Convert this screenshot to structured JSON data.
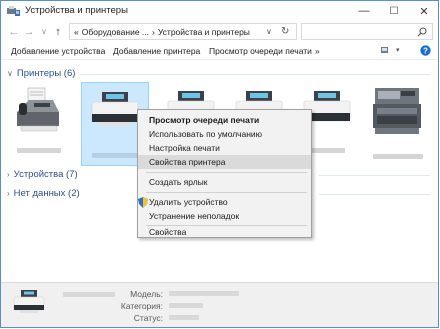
{
  "window": {
    "title": "Устройства и принтеры",
    "minimize_glyph": "—",
    "maximize_glyph": "☐",
    "close_glyph": "✕"
  },
  "nav": {
    "back_glyph": "←",
    "forward_glyph": "→",
    "dropdown_glyph": "∨",
    "up_glyph": "↑",
    "breadcrumb": [
      "«",
      "Оборудование ...",
      "›",
      "Устройства и принтеры"
    ],
    "crumb_dropdown_glyph": "∨",
    "refresh_glyph": "↻",
    "search_placeholder": ""
  },
  "commands": [
    "Добавление устройства",
    "Добавление принтера",
    "Просмотр очереди печати",
    "»"
  ],
  "groups": {
    "printers": "Принтеры (6)",
    "devices": "Устройства (7)",
    "nodata": "Нет данных (2)"
  },
  "context_menu": {
    "items": [
      "Просмотр очереди печати",
      "Использовать по умолчанию",
      "Настройка печати",
      "Свойства принтера",
      "Создать ярлык",
      "Удалить устройство",
      "Устранение неполадок",
      "Свойства"
    ]
  },
  "details": {
    "model_label": "Модель:",
    "category_label": "Категория:",
    "status_label": "Статус:"
  },
  "colors": {
    "accent": "#2d4f8e",
    "selection": "#cce8ff",
    "help": "#1a6fc9"
  }
}
